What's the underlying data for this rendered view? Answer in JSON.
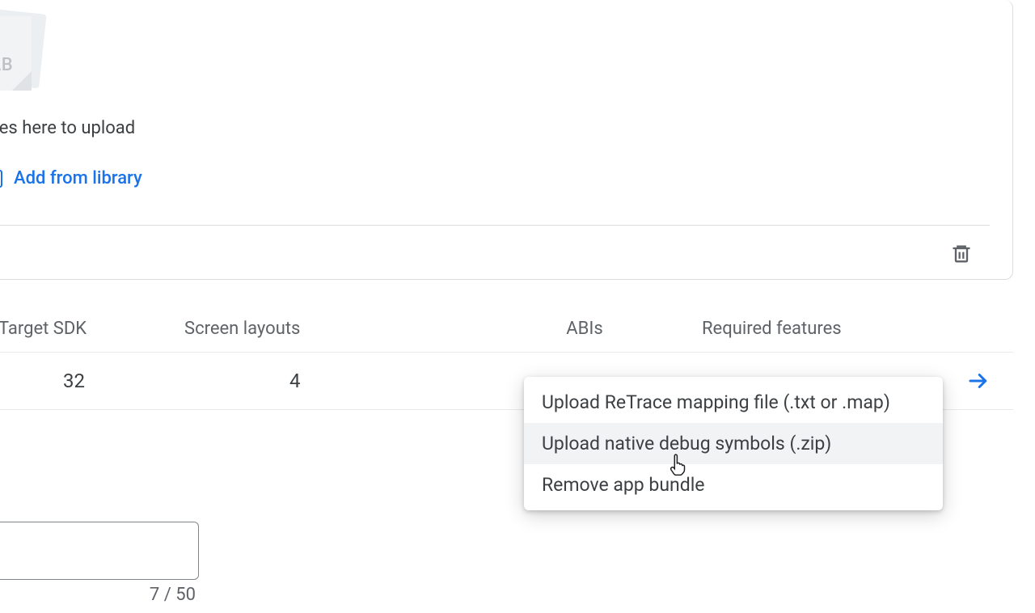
{
  "upload_area": {
    "file_badge": ".AAB",
    "drop_hint_visible": "dles here to upload",
    "add_from_library_label": "Add from library"
  },
  "columns": {
    "target_sdk": "Target SDK",
    "screen_layouts": "Screen layouts",
    "abis": "ABIs",
    "required_features": "Required features"
  },
  "row": {
    "target_sdk": "32",
    "screen_layouts": "4"
  },
  "context_menu": {
    "items": [
      "Upload ReTrace mapping file (.txt or .map)",
      "Upload native debug symbols (.zip)",
      "Remove app bundle"
    ],
    "hover_index": 1
  },
  "char_counter": "7 / 50",
  "icons": {
    "library": "add-to-library-icon",
    "trash": "trash-icon",
    "arrow": "arrow-right-icon",
    "cursor": "pointer-cursor-icon"
  },
  "colors": {
    "link": "#1a73e8",
    "text_secondary": "#5f6368",
    "border": "#dadce0"
  }
}
